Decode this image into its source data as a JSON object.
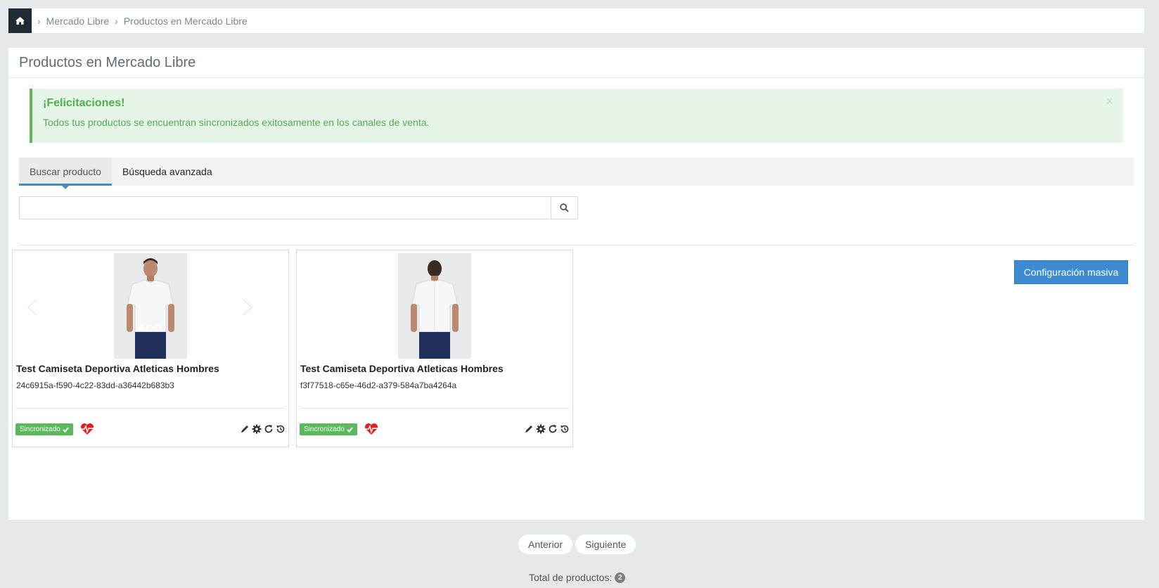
{
  "breadcrumb": {
    "items": [
      "Mercado Libre",
      "Productos en Mercado Libre"
    ]
  },
  "panel": {
    "title": "Productos en Mercado Libre"
  },
  "alert": {
    "title": "¡Felicitaciones!",
    "text": "Todos tus productos se encuentran sincronizados exitosamente en los canales de venta.",
    "close": "×"
  },
  "tabs": [
    {
      "label": "Buscar producto",
      "active": true
    },
    {
      "label": "Búsqueda avanzada",
      "active": false
    }
  ],
  "search": {
    "value": "",
    "placeholder": ""
  },
  "mass_config_label": "Configuración masiva",
  "products": [
    {
      "name": "Test Camiseta Deportiva Atleticas Hombres",
      "sku": "24c6915a-f590-4c22-83dd-a36442b683b3",
      "status": "Sincronizado",
      "view": "front"
    },
    {
      "name": "Test Camiseta Deportiva Atleticas Hombres",
      "sku": "f3f77518-c65e-46d2-a379-584a7ba4264a",
      "status": "Sincronizado",
      "view": "back"
    }
  ],
  "pagination": {
    "prev": "Anterior",
    "next": "Siguiente",
    "total_label": "Total de productos:",
    "total": "2"
  },
  "colors": {
    "accent": "#3d8bd0",
    "success": "#5cb85c",
    "heart": "#e02020"
  },
  "icons": [
    "home-icon",
    "search-icon",
    "close-icon",
    "heart-pulse-icon",
    "pencil-icon",
    "gear-icon",
    "refresh-icon",
    "history-icon",
    "check-icon",
    "chevron-left-icon",
    "chevron-right-icon"
  ]
}
